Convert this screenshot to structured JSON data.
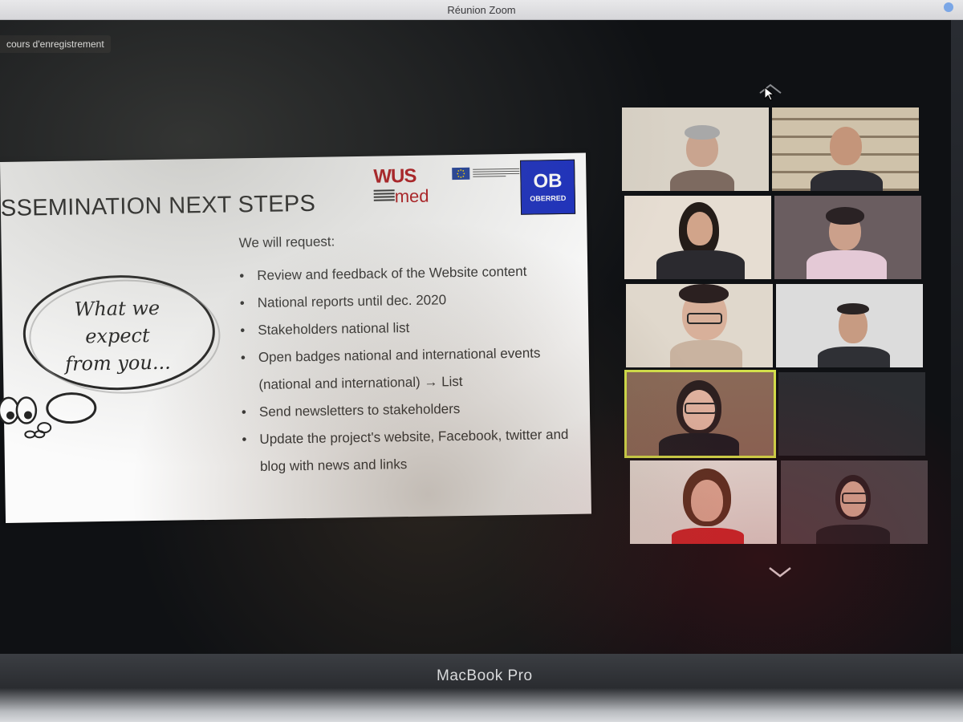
{
  "window": {
    "title": "Réunion Zoom"
  },
  "recording": {
    "label": "cours d'enregistrement"
  },
  "slide": {
    "title": "SSEMINATION NEXT STEPS",
    "logos": {
      "wus_top": "WUS",
      "wus_bottom": "med",
      "oberred_mark": "OB",
      "oberred_label": "OBERRED"
    },
    "bubble_lines": [
      "What we",
      "expect",
      "from you..."
    ],
    "request_heading": "We will request:",
    "bullets": [
      "Review and feedback of the Website content",
      "National reports until dec. 2020",
      "Stakeholders national list",
      "Open badges national and international events (national and international) → List",
      "Send newsletters to stakeholders",
      "Update the project's website, Facebook, twitter and blog with news and links"
    ]
  },
  "gallery": {
    "active_tile_color": "#d4e14a",
    "tiles": 12
  },
  "laptop": {
    "brand": "MacBook Pro"
  },
  "colors": {
    "wus_red": "#b3151b",
    "oberred_blue": "#1b2fbf",
    "eu_blue": "#1f3f9a"
  }
}
